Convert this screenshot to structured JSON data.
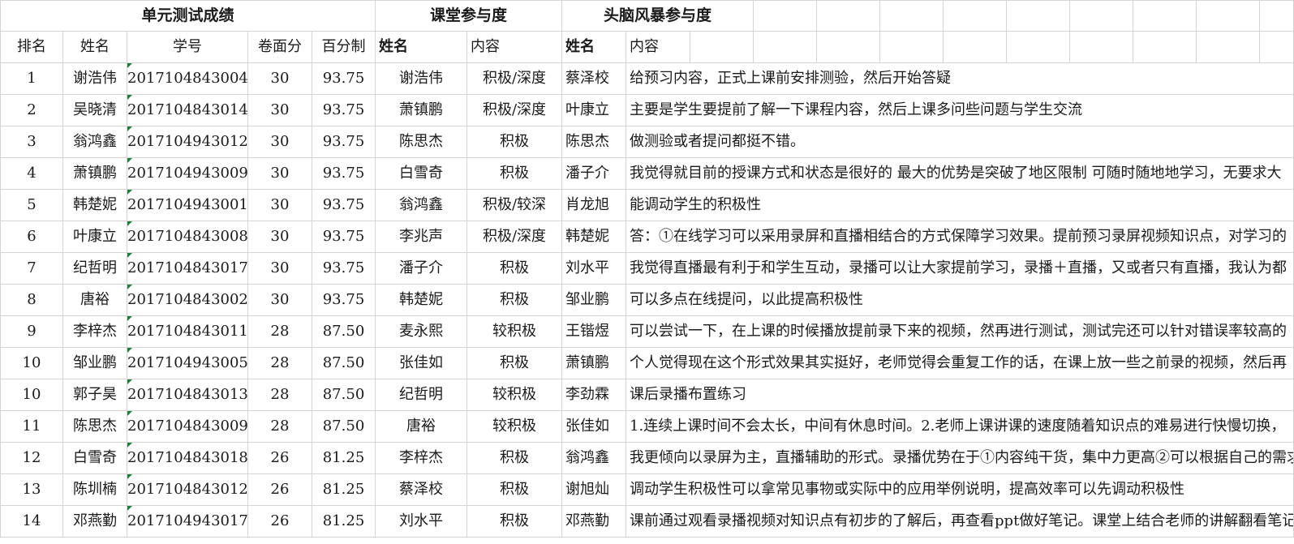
{
  "header": {
    "group_scores": "单元测试成绩",
    "group_participation": "课堂参与度",
    "group_brainstorm": "头脑风暴参与度"
  },
  "columns": {
    "rank": "排名",
    "name": "姓名",
    "id": "学号",
    "raw": "卷面分",
    "percent": "百分制",
    "p_name": "姓名",
    "p_content": "内容",
    "b_name": "姓名",
    "b_content": "内容"
  },
  "rows": [
    {
      "rank": "1",
      "name": "谢浩伟",
      "id": "2017104843004",
      "raw": "30",
      "percent": "93.75",
      "p_name": "谢浩伟",
      "p_content": "积极/深度",
      "b_name": "蔡泽校",
      "b_content": "给预习内容，正式上课前安排测验，然后开始答疑"
    },
    {
      "rank": "2",
      "name": "吴晓清",
      "id": "2017104843014",
      "raw": "30",
      "percent": "93.75",
      "p_name": "萧镇鹏",
      "p_content": "积极/深度",
      "b_name": "叶康立",
      "b_content": "主要是学生要提前了解一下课程内容，然后上课多问些问题与学生交流"
    },
    {
      "rank": "3",
      "name": "翁鸿鑫",
      "id": "2017104943012",
      "raw": "30",
      "percent": "93.75",
      "p_name": "陈思杰",
      "p_content": "积极",
      "b_name": "陈思杰",
      "b_content": "做测验或者提问都挺不错。"
    },
    {
      "rank": "4",
      "name": "萧镇鹏",
      "id": "2017104943009",
      "raw": "30",
      "percent": "93.75",
      "p_name": "白雪奇",
      "p_content": "积极",
      "b_name": "潘子介",
      "b_content": "我觉得就目前的授课方式和状态是很好的 最大的优势是突破了地区限制 可随时随地地学习，无要求大"
    },
    {
      "rank": "5",
      "name": "韩楚妮",
      "id": "2017104943001",
      "raw": "30",
      "percent": "93.75",
      "p_name": "翁鸿鑫",
      "p_content": "积极/较深",
      "b_name": "肖龙旭",
      "b_content": "能调动学生的积极性"
    },
    {
      "rank": "6",
      "name": "叶康立",
      "id": "2017104843008",
      "raw": "30",
      "percent": "93.75",
      "p_name": "李兆声",
      "p_content": "积极/深度",
      "b_name": "韩楚妮",
      "b_content": "答：①在线学习可以采用录屏和直播相结合的方式保障学习效果。提前预习录屏视频知识点，对学习的"
    },
    {
      "rank": "7",
      "name": "纪哲明",
      "id": "2017104843017",
      "raw": "30",
      "percent": "93.75",
      "p_name": "潘子介",
      "p_content": "积极",
      "b_name": "刘水平",
      "b_content": "我觉得直播最有利于和学生互动，录播可以让大家提前学习，录播＋直播，又或者只有直播，我认为都"
    },
    {
      "rank": "8",
      "name": "唐裕",
      "id": "2017104843002",
      "raw": "30",
      "percent": "93.75",
      "p_name": "韩楚妮",
      "p_content": "积极",
      "b_name": "邹业鹏",
      "b_content": "可以多点在线提问，以此提高积极性"
    },
    {
      "rank": "9",
      "name": "李梓杰",
      "id": "2017104843011",
      "raw": "28",
      "percent": "87.50",
      "p_name": "麦永熙",
      "p_content": "较积极",
      "b_name": "王锴煜",
      "b_content": "可以尝试一下，在上课的时候播放提前录下来的视频，然再进行测试，测试完还可以针对错误率较高的"
    },
    {
      "rank": "10",
      "name": "邹业鹏",
      "id": "2017104943005",
      "raw": "28",
      "percent": "87.50",
      "p_name": "张佳如",
      "p_content": "积极",
      "b_name": "萧镇鹏",
      "b_content": "个人觉得现在这个形式效果其实挺好，老师觉得会重复工作的话，在课上放一些之前录的视频，然后再"
    },
    {
      "rank": "10",
      "name": "郭子昊",
      "id": "2017104843013",
      "raw": "28",
      "percent": "87.50",
      "p_name": "纪哲明",
      "p_content": "较积极",
      "b_name": "李劲霖",
      "b_content": "课后录播布置练习"
    },
    {
      "rank": "11",
      "name": "陈思杰",
      "id": "2017104843009",
      "raw": "28",
      "percent": "87.50",
      "p_name": "唐裕",
      "p_content": "较积极",
      "b_name": "张佳如",
      "b_content": "1.连续上课时间不会太长，中间有休息时间。2.老师上课讲课的速度随着知识点的难易进行快慢切换，"
    },
    {
      "rank": "12",
      "name": "白雪奇",
      "id": "2017104843018",
      "raw": "26",
      "percent": "81.25",
      "p_name": "李梓杰",
      "p_content": "积极",
      "b_name": "翁鸿鑫",
      "b_content": "我更倾向以录屏为主，直播辅助的形式。录播优势在于①内容纯干货，集中力更高②可以根据自己的需求"
    },
    {
      "rank": "13",
      "name": "陈圳楠",
      "id": "2017104843012",
      "raw": "26",
      "percent": "81.25",
      "p_name": "蔡泽校",
      "p_content": "积极",
      "b_name": "谢旭灿",
      "b_content": "调动学生积极性可以拿常见事物或实际中的应用举例说明，提高效率可以先调动积极性"
    },
    {
      "rank": "14",
      "name": "邓燕勤",
      "id": "2017104943017",
      "raw": "26",
      "percent": "81.25",
      "p_name": "刘水平",
      "p_content": "积极",
      "b_name": "邓燕勤",
      "b_content": "课前通过观看录播视频对知识点有初步的了解后，再查看ppt做好笔记。课堂上结合老师的讲解翻看笔记"
    }
  ]
}
